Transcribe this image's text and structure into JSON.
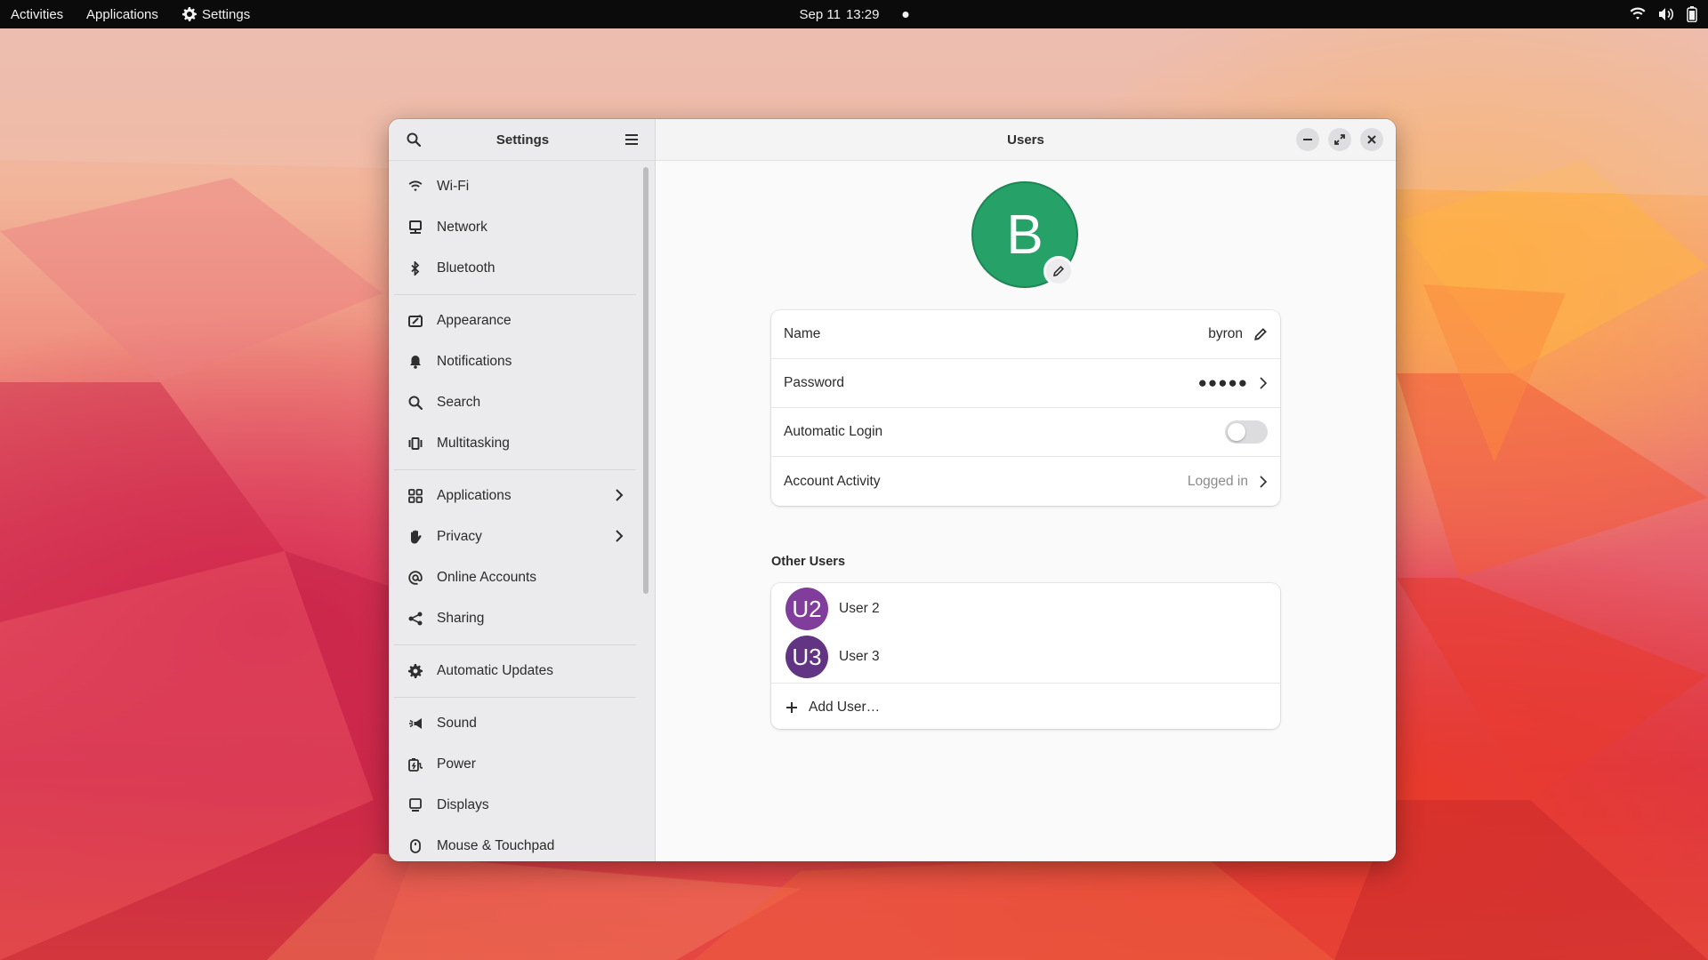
{
  "topbar": {
    "activities": "Activities",
    "applications": "Applications",
    "app_name": "Settings",
    "date": "Sep 11",
    "time": "13:29",
    "tray_icons": [
      "wifi-icon",
      "volume-icon",
      "battery-icon"
    ]
  },
  "sidebar": {
    "title": "Settings",
    "groups": [
      [
        {
          "label": "Wi-Fi",
          "icon": "wifi-icon"
        },
        {
          "label": "Network",
          "icon": "network-icon"
        },
        {
          "label": "Bluetooth",
          "icon": "bluetooth-icon"
        }
      ],
      [
        {
          "label": "Appearance",
          "icon": "appearance-icon"
        },
        {
          "label": "Notifications",
          "icon": "bell-icon"
        },
        {
          "label": "Search",
          "icon": "search-icon"
        },
        {
          "label": "Multitasking",
          "icon": "multitasking-icon"
        }
      ],
      [
        {
          "label": "Applications",
          "icon": "apps-grid-icon",
          "has_submenu": true
        },
        {
          "label": "Privacy",
          "icon": "hand-icon",
          "has_submenu": true
        },
        {
          "label": "Online Accounts",
          "icon": "at-icon"
        },
        {
          "label": "Sharing",
          "icon": "share-icon"
        }
      ],
      [
        {
          "label": "Automatic Updates",
          "icon": "gear-icon"
        }
      ],
      [
        {
          "label": "Sound",
          "icon": "speaker-icon"
        },
        {
          "label": "Power",
          "icon": "power-icon"
        },
        {
          "label": "Displays",
          "icon": "display-icon"
        },
        {
          "label": "Mouse & Touchpad",
          "icon": "mouse-icon"
        }
      ]
    ]
  },
  "content": {
    "title": "Users",
    "current_user_initial": "B",
    "avatar_color": "#26a269",
    "rows": {
      "name_label": "Name",
      "name_value": "byron",
      "password_label": "Password",
      "password_value": "●●●●●",
      "autologin_label": "Automatic Login",
      "autologin_on": false,
      "activity_label": "Account Activity",
      "activity_value": "Logged in"
    },
    "other_users_title": "Other Users",
    "other_users": [
      {
        "initials": "U2",
        "name": "User 2",
        "color": "#813d9c"
      },
      {
        "initials": "U3",
        "name": "User 3",
        "color": "#613583"
      }
    ],
    "add_user_label": "Add User…"
  }
}
